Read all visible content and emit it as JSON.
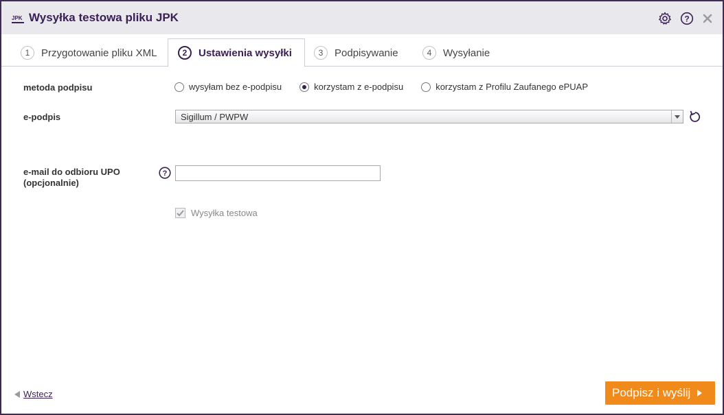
{
  "window": {
    "title": "Wysyłka testowa pliku JPK",
    "app_icon_text": "JPK"
  },
  "tabs": [
    {
      "num": "1",
      "label": "Przygotowanie pliku XML",
      "active": false
    },
    {
      "num": "2",
      "label": "Ustawienia wysyłki",
      "active": true
    },
    {
      "num": "3",
      "label": "Podpisywanie",
      "active": false
    },
    {
      "num": "4",
      "label": "Wysyłanie",
      "active": false
    }
  ],
  "form": {
    "signature_method_label": "metoda podpisu",
    "signature_options": [
      {
        "label": "wysyłam bez e-podpisu",
        "selected": false
      },
      {
        "label": "korzystam z e-podpisu",
        "selected": true
      },
      {
        "label": "korzystam z Profilu Zaufanego ePUAP",
        "selected": false
      }
    ],
    "epodpis_label": "e-podpis",
    "epodpis_value": "Sigillum / PWPW",
    "email_label_line1": "e-mail do odbioru UPO",
    "email_label_line2": "(opcjonalnie)",
    "email_value": "",
    "test_checkbox_label": "Wysyłka testowa",
    "test_checkbox_checked": true
  },
  "footer": {
    "back_label": "Wstecz",
    "primary_label": "Podpisz i wyślij"
  },
  "colors": {
    "brand": "#3a1f55",
    "primary_button": "#f08a1a"
  },
  "icons": [
    "gear-icon",
    "help-icon",
    "close-icon",
    "refresh-icon",
    "question-icon"
  ]
}
